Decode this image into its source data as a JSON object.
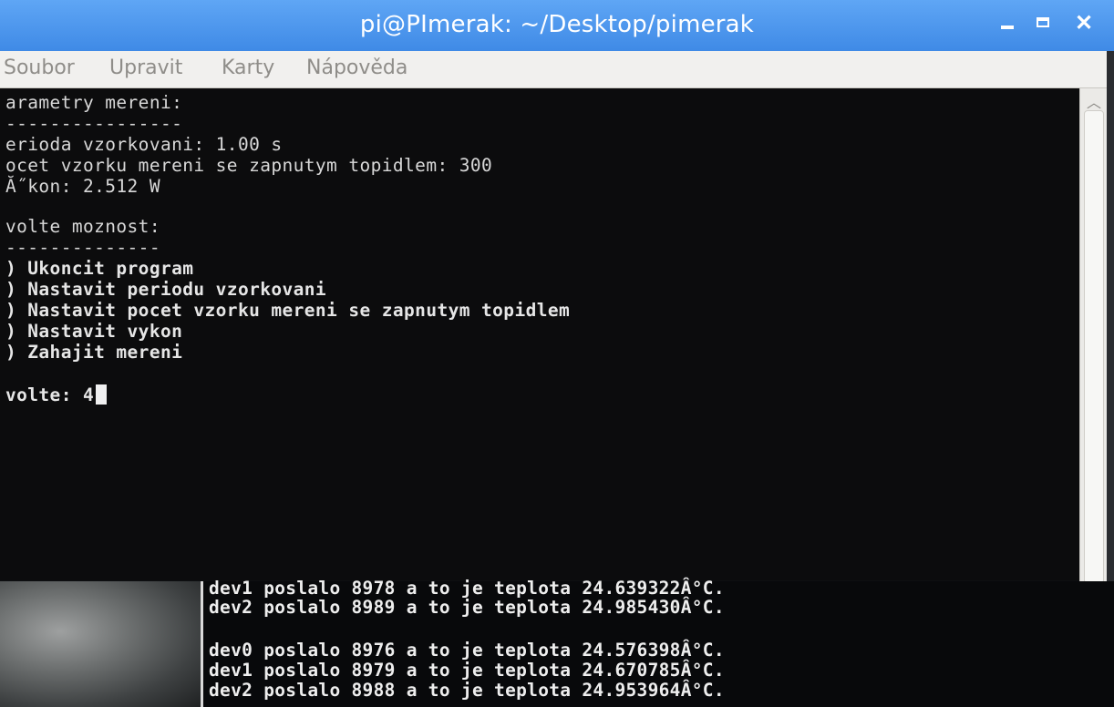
{
  "window": {
    "title": "pi@PImerak: ~/Desktop/pimerak"
  },
  "menu": {
    "items": [
      {
        "label": "Soubor"
      },
      {
        "label": "Upravit"
      },
      {
        "label": "Karty"
      },
      {
        "label": "Nápověda"
      }
    ]
  },
  "terminal": {
    "lines": [
      "arametry mereni:",
      "----------------",
      "erioda vzorkovani: 1.00 s",
      "ocet vzorku mereni se zapnutym topidlem: 300",
      "Ă˝kon: 2.512 W",
      "",
      "volte moznost:",
      "--------------",
      ") Ukoncit program",
      ") Nastavit periodu vzorkovani",
      ") Nastavit pocet vzorku mereni se zapnutym topidlem",
      ") Nastavit vykon",
      ") Zahajit mereni",
      "",
      "volte: 4"
    ]
  },
  "background_terminal": {
    "lines": [
      "dev1 poslalo 8978 a to je teplota 24.639322Â°C.",
      "dev2 poslalo 8989 a to je teplota 24.985430Â°C.",
      "",
      "dev0 poslalo 8976 a to je teplota 24.576398Â°C.",
      "dev1 poslalo 8979 a to je teplota 24.670785Â°C.",
      "dev2 poslalo 8988 a to je teplota 24.953964Â°C."
    ]
  },
  "icons": {
    "minimize": "minimize-icon",
    "maximize": "maximize-icon",
    "close": "close-icon",
    "scroll_up": "chevron-up-icon"
  },
  "colors": {
    "titlebar": "#4a95ee",
    "terminal_bg": "#0c0c0d",
    "terminal_fg": "#d8d8d8",
    "menubar_bg": "#f1f0ee"
  }
}
